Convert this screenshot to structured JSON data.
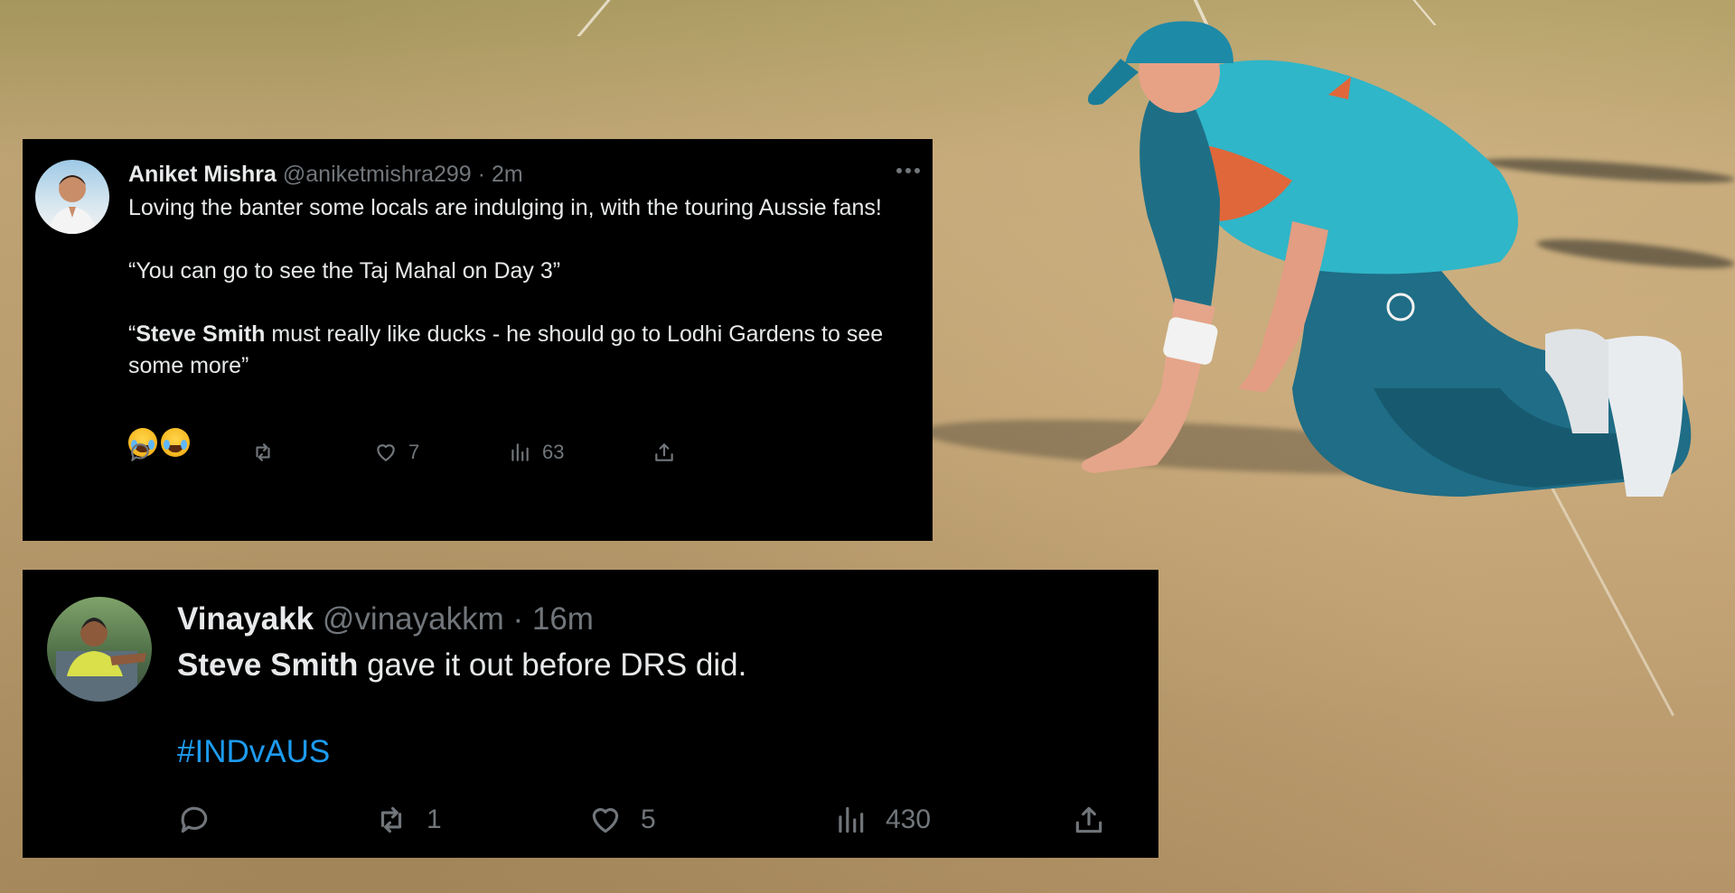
{
  "tweets": [
    {
      "author": {
        "name": "Aniket Mishra",
        "handle": "@aniketmishra299",
        "time": "2m"
      },
      "separator": "·",
      "body": {
        "line1": "Loving the banter some locals are indulging in, with the touring Aussie fans!",
        "quote1": "“You can go to see the Taj Mahal on Day 3”",
        "quote2_open": "“",
        "quote2_bold": "Steve Smith",
        "quote2_rest": " must really like ducks - he should go to Lodhi Gardens to see some more”",
        "emoji_label": "😂😂"
      },
      "stats": {
        "replies": "",
        "reposts": "",
        "likes": "7",
        "views": "63"
      },
      "icons": [
        "avatar",
        "more-icon",
        "reply-icon",
        "repost-icon",
        "like-icon",
        "views-icon",
        "share-icon"
      ]
    },
    {
      "author": {
        "name": "Vinayakk",
        "handle": "@vinayakkm",
        "time": "16m"
      },
      "separator": "·",
      "body": {
        "bold": "Steve Smith",
        "rest": " gave it out before DRS did.",
        "hashtag": "#INDvAUS"
      },
      "stats": {
        "replies": "",
        "reposts": "1",
        "likes": "5",
        "views": "430"
      },
      "icons": [
        "avatar",
        "reply-icon",
        "repost-icon",
        "like-icon",
        "views-icon",
        "share-icon"
      ]
    }
  ],
  "colors": {
    "card_background": "#000000",
    "text_primary": "#e7e9ea",
    "text_secondary": "#71767b",
    "link": "#1d9bf0",
    "pitch": "#c4a577",
    "jersey": "#2fb6c8",
    "trousers": "#1f6d86"
  }
}
